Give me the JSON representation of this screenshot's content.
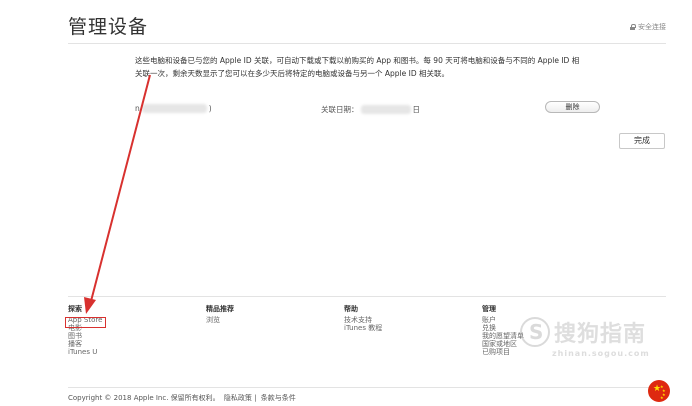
{
  "header": {
    "title": "管理设备",
    "secure_label": "安全连接"
  },
  "description": "这些电脑和设备已与您的 Apple ID 关联，可自动下载或下载以前购买的 App 和图书。每 90 天可将电脑和设备与不同的 Apple ID 相关联一次，剩余天数显示了您可以在多少天后将特定的电脑或设备与另一个 Apple ID 相关联。",
  "device": {
    "name_prefix": "n",
    "name_suffix": ")",
    "date_label": "关联日期：",
    "date_suffix": "日",
    "remove_label": "删除"
  },
  "done_label": "完成",
  "footer": {
    "columns": [
      {
        "heading": "探索",
        "items": [
          "App Store",
          "电影",
          "图书",
          "播客",
          "iTunes U"
        ]
      },
      {
        "heading": "精品推荐",
        "items": [
          "浏览"
        ]
      },
      {
        "heading": "帮助",
        "items": [
          "技术支持",
          "iTunes 教程"
        ]
      },
      {
        "heading": "管理",
        "items": [
          "账户",
          "兑换",
          "我的愿望清单",
          "国家或地区",
          "已购项目"
        ]
      }
    ],
    "copyright": "Copyright © 2018 Apple Inc. 保留所有权利。",
    "privacy": "隐私政策",
    "separator": "|",
    "terms": "条款与条件"
  },
  "watermark": {
    "text": "搜狗指南",
    "url": "zhinan.sogou.com"
  },
  "colors": {
    "highlight": "#d8312f",
    "flag_red": "#de2910",
    "flag_star": "#ffde00"
  }
}
